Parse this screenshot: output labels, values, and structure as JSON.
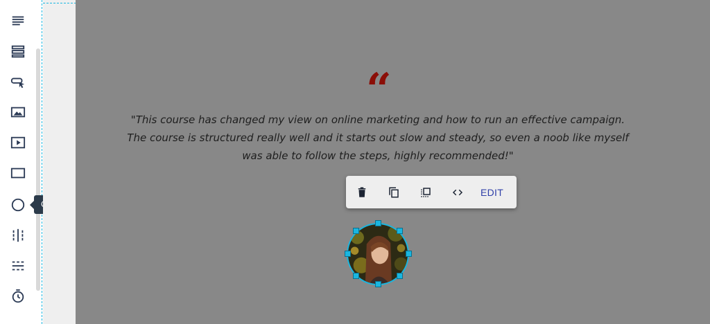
{
  "sidebar": {
    "tools": [
      {
        "icon": "text-paragraph-icon"
      },
      {
        "icon": "rows-layout-icon"
      },
      {
        "icon": "button-cursor-icon"
      },
      {
        "icon": "image-icon"
      },
      {
        "icon": "video-play-icon"
      },
      {
        "icon": "rectangle-icon"
      },
      {
        "icon": "circle-icon"
      },
      {
        "icon": "column-divider-icon"
      },
      {
        "icon": "horizontal-divider-icon"
      },
      {
        "icon": "timer-icon"
      }
    ],
    "tooltip": "Circle"
  },
  "canvas": {
    "quote_mark": "“",
    "quote_lines": [
      "\"This course has changed my view on online marketing and how to run an effective campaign.",
      "The course is structured really well and it starts out slow and steady, so even a noob like myself",
      "was able to follow the steps, highly recommended!\""
    ]
  },
  "toolbar": {
    "buttons": [
      "delete-icon",
      "duplicate-icon",
      "select-parent-icon",
      "code-icon"
    ],
    "edit_label": "EDIT"
  },
  "colors": {
    "accent": "#19b6e0",
    "quote": "#8b0e07",
    "stage": "#888888",
    "edit": "#2f3fa8",
    "tooltip_bg": "#2b3a4a"
  }
}
